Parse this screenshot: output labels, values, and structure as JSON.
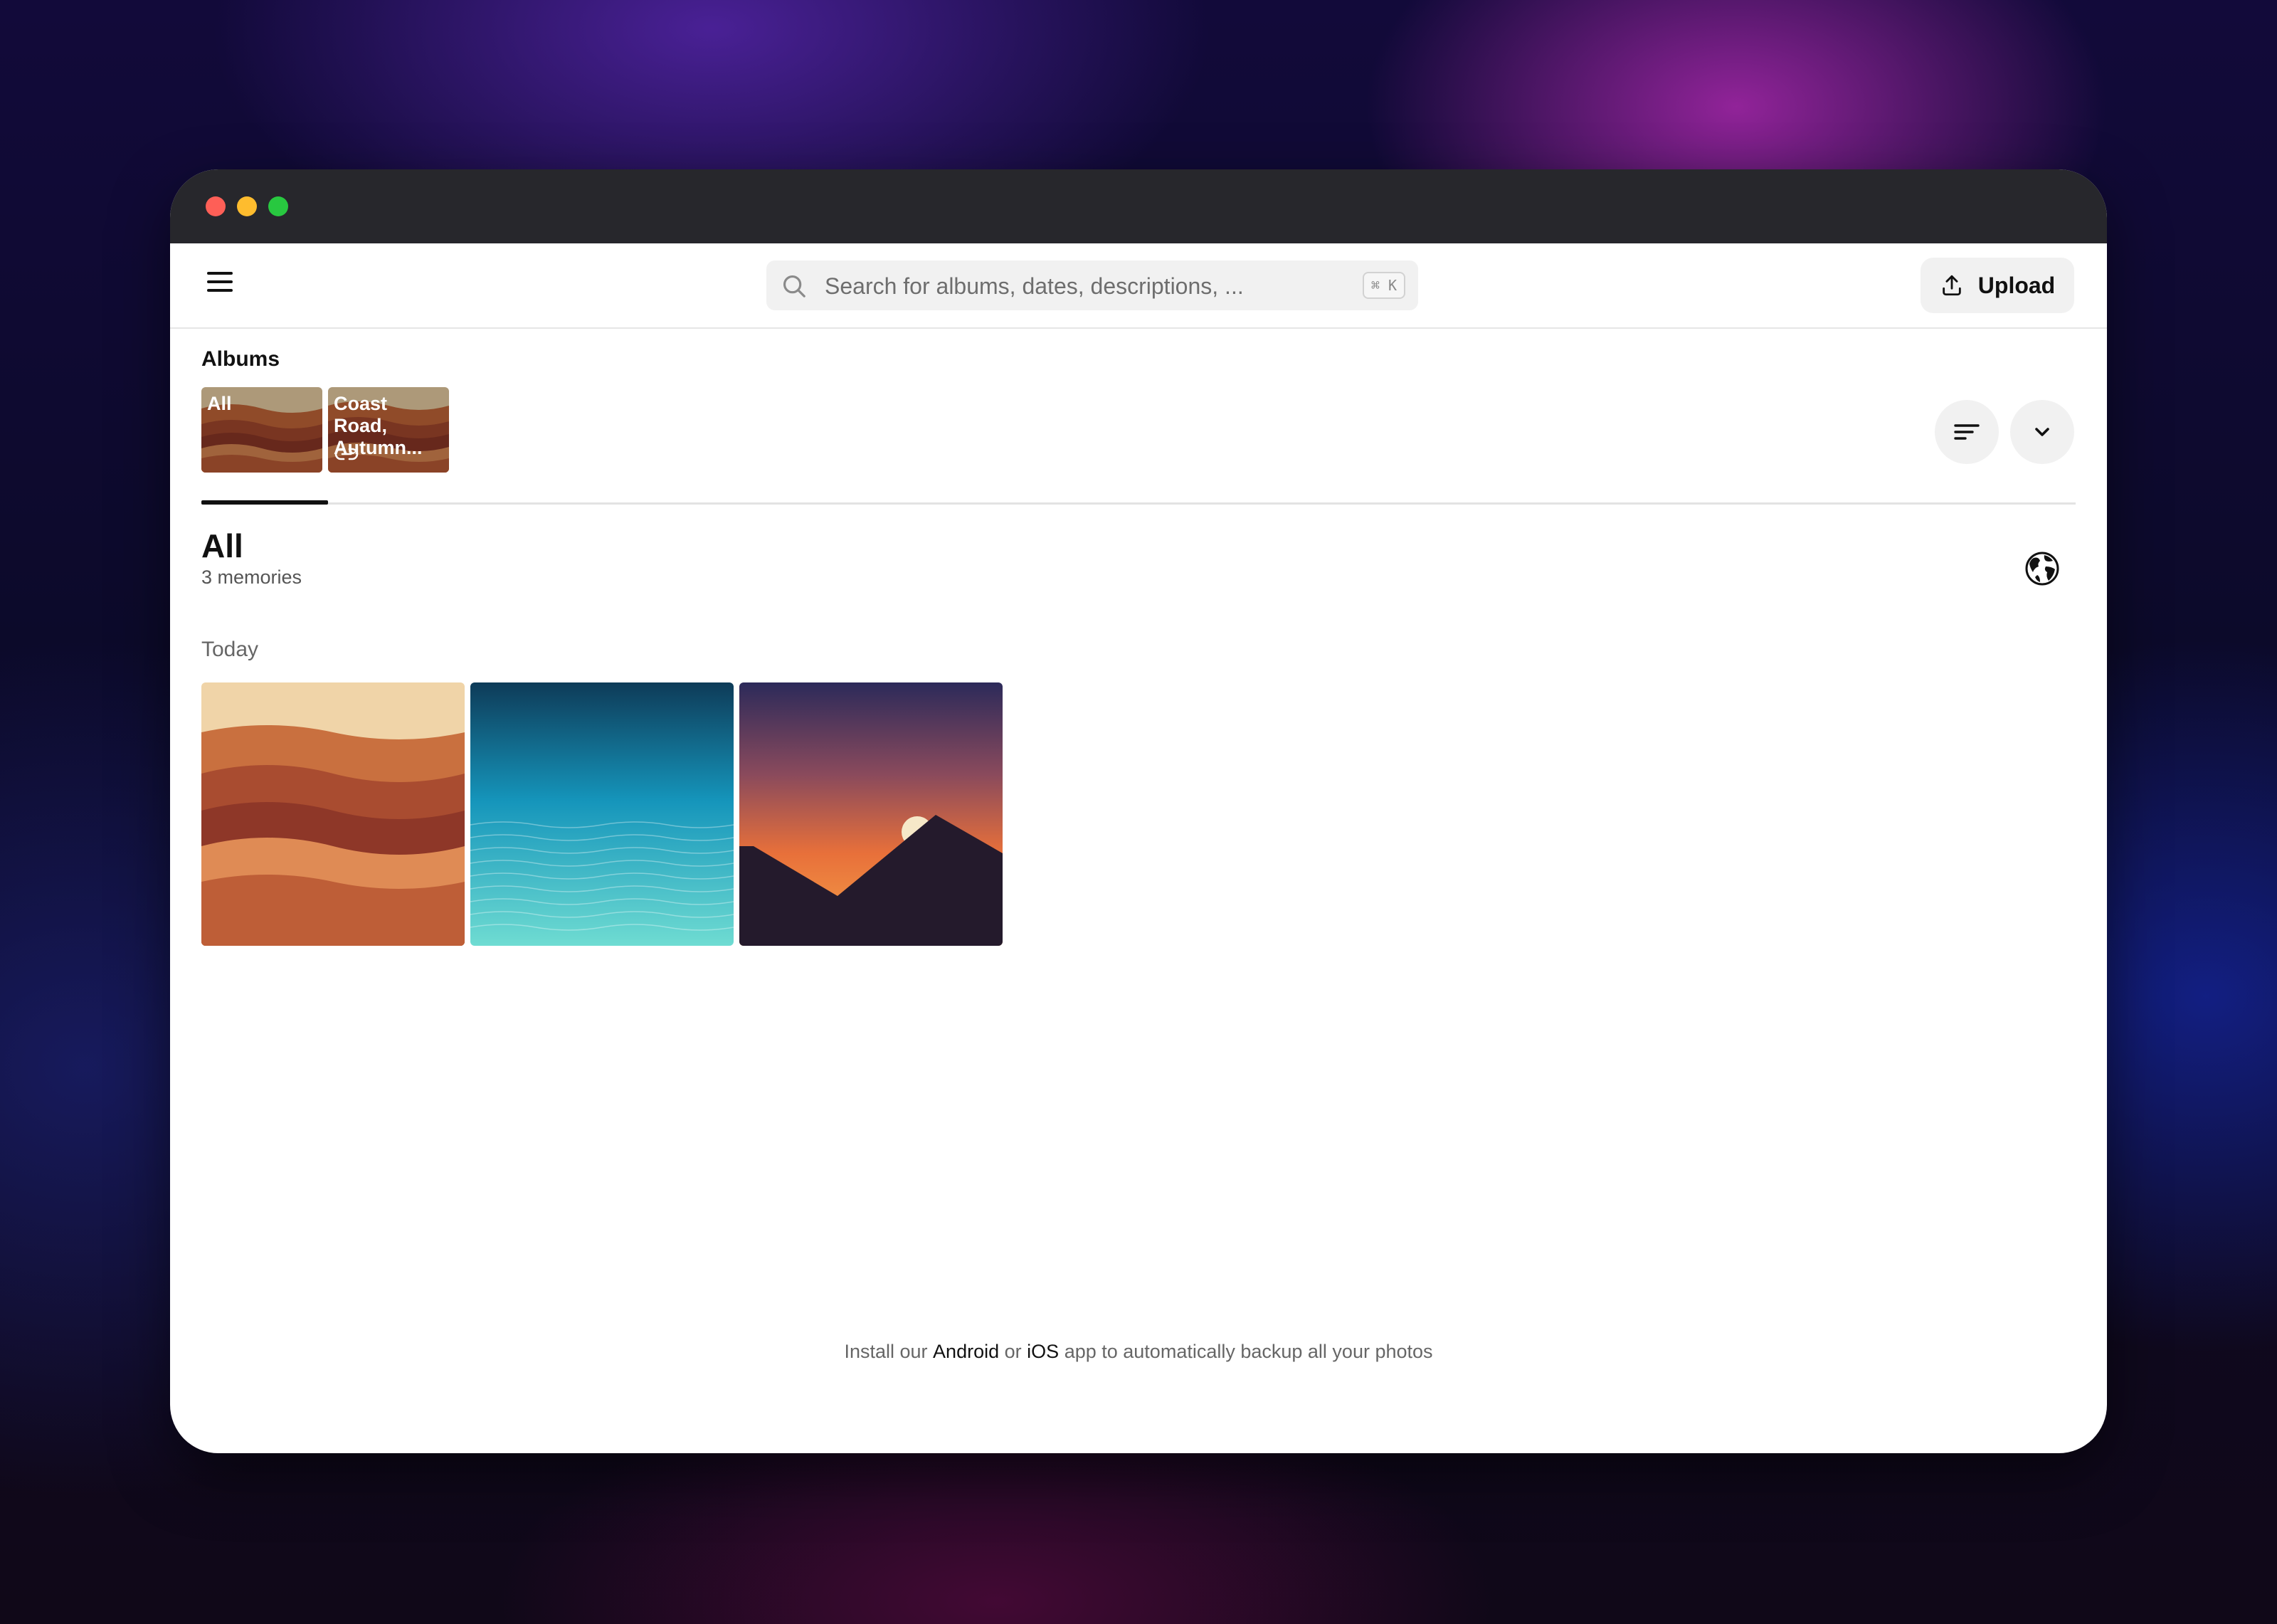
{
  "window": {
    "traffic_lights": [
      "close",
      "minimize",
      "zoom"
    ]
  },
  "header": {
    "menu_icon": "hamburger-menu-icon",
    "search": {
      "placeholder": "Search for albums, dates, descriptions, ...",
      "shortcut": "⌘ K",
      "icon": "search-icon"
    },
    "upload": {
      "label": "Upload",
      "icon": "upload-icon"
    }
  },
  "albums": {
    "heading": "Albums",
    "items": [
      {
        "name": "All"
      },
      {
        "name": "Coast Road, Autumn...",
        "shared_icon": "link-icon"
      }
    ],
    "sort_icon": "sort-icon",
    "expand_icon": "chevron-down-icon"
  },
  "section": {
    "title": "All",
    "subtitle": "3 memories",
    "map_icon": "globe-icon",
    "day_label": "Today"
  },
  "photos": [
    {
      "name": "desert-waves"
    },
    {
      "name": "ocean"
    },
    {
      "name": "mountain-sunset"
    }
  ],
  "footer": {
    "prefix": "Install our",
    "android": "Android",
    "or": "or",
    "ios": "iOS",
    "suffix": "app to automatically backup all your photos"
  }
}
